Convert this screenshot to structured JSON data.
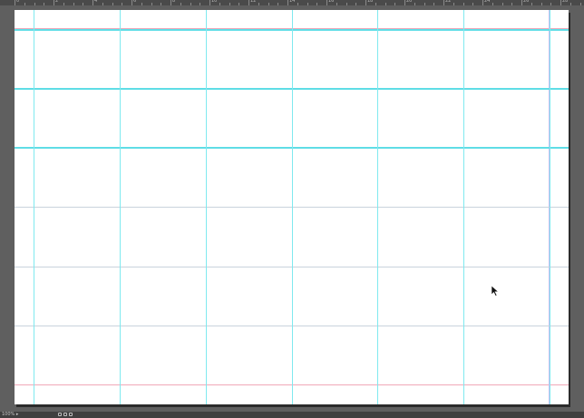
{
  "ruler": {
    "labels": [
      "0",
      "2",
      "4",
      "6",
      "8",
      "10",
      "12",
      "14",
      "16",
      "18",
      "20",
      "22",
      "24",
      "26",
      "28"
    ]
  },
  "status_bar": {
    "text": "100% ▸ "
  },
  "colors": {
    "canvas_bg": "#5f5f5f",
    "artboard": "#ffffff",
    "guide_cyan": "#7fe9ef",
    "grid_line": "#c9d3dc",
    "margin_pink": "#f0a8b8",
    "margin_purple": "#c8bdf0"
  },
  "icons": {
    "cursor": "arrow-pointer-icon"
  }
}
